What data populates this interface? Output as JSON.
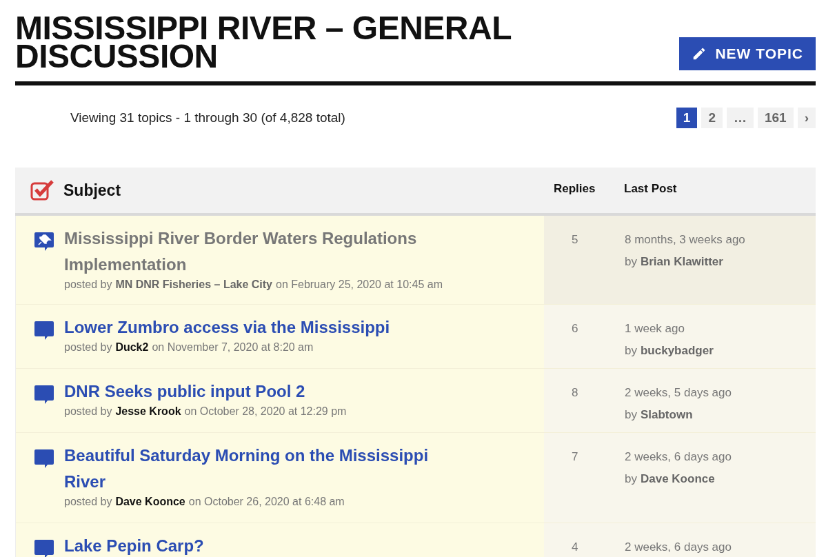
{
  "forum": {
    "title": "MISSISSIPPI RIVER – GENERAL DISCUSSION",
    "new_topic_button": "NEW TOPIC"
  },
  "summary": "Viewing 31 topics - 1 through 30 (of 4,828 total)",
  "pagination": [
    {
      "label": "1",
      "selected": true
    },
    {
      "label": "2",
      "selected": false
    },
    {
      "label": "…",
      "selected": false
    },
    {
      "label": "161",
      "selected": false
    },
    {
      "label": "›",
      "selected": false
    }
  ],
  "table": {
    "columns": [
      "Subject",
      "Replies",
      "Last Post"
    ],
    "rows": [
      {
        "kind": "sticky",
        "title": "Mississippi River Border Waters Regulations Implementation",
        "posted_by_label": "posted by",
        "author": "MN DNR Fisheries – Lake City",
        "date": "on February 25, 2020 at 10:45 am",
        "replies": "5",
        "last_post": "8 months, 3 weeks ago",
        "by_label": "by",
        "last_author": "Brian Klawitter"
      },
      {
        "kind": "normal",
        "title": "Lower Zumbro access via the Mississippi",
        "posted_by_label": "posted by",
        "author": "Duck2",
        "date": "on November 7, 2020 at 8:20 am",
        "replies": "6",
        "last_post": "1 week ago",
        "by_label": "by",
        "last_author": "buckybadger"
      },
      {
        "kind": "normal",
        "title": "DNR Seeks public input Pool 2",
        "posted_by_label": "posted by",
        "author": "Jesse Krook",
        "date": "on October 28, 2020 at 12:29 pm",
        "replies": "8",
        "last_post": "2 weeks, 5 days ago",
        "by_label": "by",
        "last_author": "Slabtown"
      },
      {
        "kind": "normal",
        "title": "Beautiful Saturday Morning on the Mississippi River",
        "posted_by_label": "posted by",
        "author": "Dave Koonce",
        "date": "on October 26, 2020 at 6:48 am",
        "replies": "7",
        "last_post": "2 weeks, 6 days ago",
        "by_label": "by",
        "last_author": "Dave Koonce"
      },
      {
        "kind": "normal",
        "title": "Lake Pepin Carp?",
        "replies": "4",
        "last_post": "2 weeks, 6 days ago"
      }
    ]
  }
}
